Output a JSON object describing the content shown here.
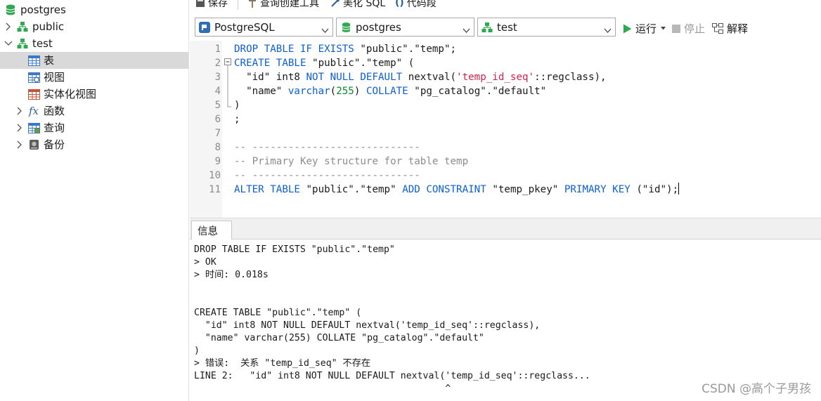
{
  "sidebar": {
    "items": [
      {
        "label": "postgres",
        "icon": "database-icon"
      },
      {
        "label": "public",
        "icon": "schema-icon"
      },
      {
        "label": "test",
        "icon": "schema-icon"
      },
      {
        "label": "表",
        "icon": "table-icon"
      },
      {
        "label": "视图",
        "icon": "view-icon"
      },
      {
        "label": "实体化视图",
        "icon": "materialized-view-icon"
      },
      {
        "label": "函数",
        "icon": "function-icon",
        "glyph": "fx"
      },
      {
        "label": "查询",
        "icon": "query-icon"
      },
      {
        "label": "备份",
        "icon": "backup-icon"
      }
    ]
  },
  "toolbar": {
    "save_label": "保存",
    "query_builder_label": "查询创建工具",
    "beautify_label": "美化 SQL",
    "snippet_label": "代码段",
    "run_label": "运行",
    "stop_label": "停止",
    "explain_label": "解释"
  },
  "selectors": {
    "connection": "PostgreSQL",
    "database": "postgres",
    "schema": "test"
  },
  "editor": {
    "line_numbers": [
      "1",
      "2",
      "3",
      "4",
      "5",
      "6",
      "7",
      "8",
      "9",
      "10",
      "11"
    ],
    "lines": [
      [
        {
          "t": "kw",
          "v": "DROP TABLE IF EXISTS"
        },
        {
          "t": "p",
          "v": " \"public\".\"temp\";"
        }
      ],
      [
        {
          "t": "kw",
          "v": "CREATE TABLE"
        },
        {
          "t": "p",
          "v": " \"public\".\"temp\" ("
        }
      ],
      [
        {
          "t": "p",
          "v": "  \"id\" int8 "
        },
        {
          "t": "kw",
          "v": "NOT NULL DEFAULT"
        },
        {
          "t": "p",
          "v": " nextval("
        },
        {
          "t": "str",
          "v": "'temp_id_seq'"
        },
        {
          "t": "p",
          "v": "::regclass),"
        }
      ],
      [
        {
          "t": "p",
          "v": "  \"name\" "
        },
        {
          "t": "kw",
          "v": "varchar"
        },
        {
          "t": "p",
          "v": "("
        },
        {
          "t": "num",
          "v": "255"
        },
        {
          "t": "p",
          "v": ") "
        },
        {
          "t": "kw",
          "v": "COLLATE"
        },
        {
          "t": "p",
          "v": " \"pg_catalog\".\"default\""
        }
      ],
      [
        {
          "t": "p",
          "v": ")"
        }
      ],
      [
        {
          "t": "p",
          "v": ";"
        }
      ],
      [],
      [
        {
          "t": "cm",
          "v": "-- ----------------------------"
        }
      ],
      [
        {
          "t": "cm",
          "v": "-- Primary Key structure for table temp"
        }
      ],
      [
        {
          "t": "cm",
          "v": "-- ----------------------------"
        }
      ],
      [
        {
          "t": "kw",
          "v": "ALTER TABLE"
        },
        {
          "t": "p",
          "v": " \"public\".\"temp\" "
        },
        {
          "t": "kw",
          "v": "ADD CONSTRAINT"
        },
        {
          "t": "p",
          "v": " \"temp_pkey\" "
        },
        {
          "t": "kw",
          "v": "PRIMARY KEY"
        },
        {
          "t": "p",
          "v": " (\"id\");"
        }
      ]
    ]
  },
  "panel": {
    "tab_label": "信息",
    "output": [
      "DROP TABLE IF EXISTS \"public\".\"temp\"",
      "> OK",
      "> 时间: 0.018s",
      "",
      "",
      "CREATE TABLE \"public\".\"temp\" (",
      "  \"id\" int8 NOT NULL DEFAULT nextval('temp_id_seq'::regclass),",
      "  \"name\" varchar(255) COLLATE \"pg_catalog\".\"default\"",
      ")",
      "> 错误:  关系 \"temp_id_seq\" 不存在",
      "LINE 2:   \"id\" int8 NOT NULL DEFAULT nextval('temp_id_seq'::regclass...",
      "                                             ^"
    ]
  },
  "watermark": "CSDN @高个子男孩",
  "colors": {
    "keyword": "#0b5fd6",
    "string": "#d0244a",
    "number": "#0a8a2a",
    "comment": "#8c8c8c",
    "db_green": "#2fa84f",
    "selected_row": "#d9d9d9"
  }
}
